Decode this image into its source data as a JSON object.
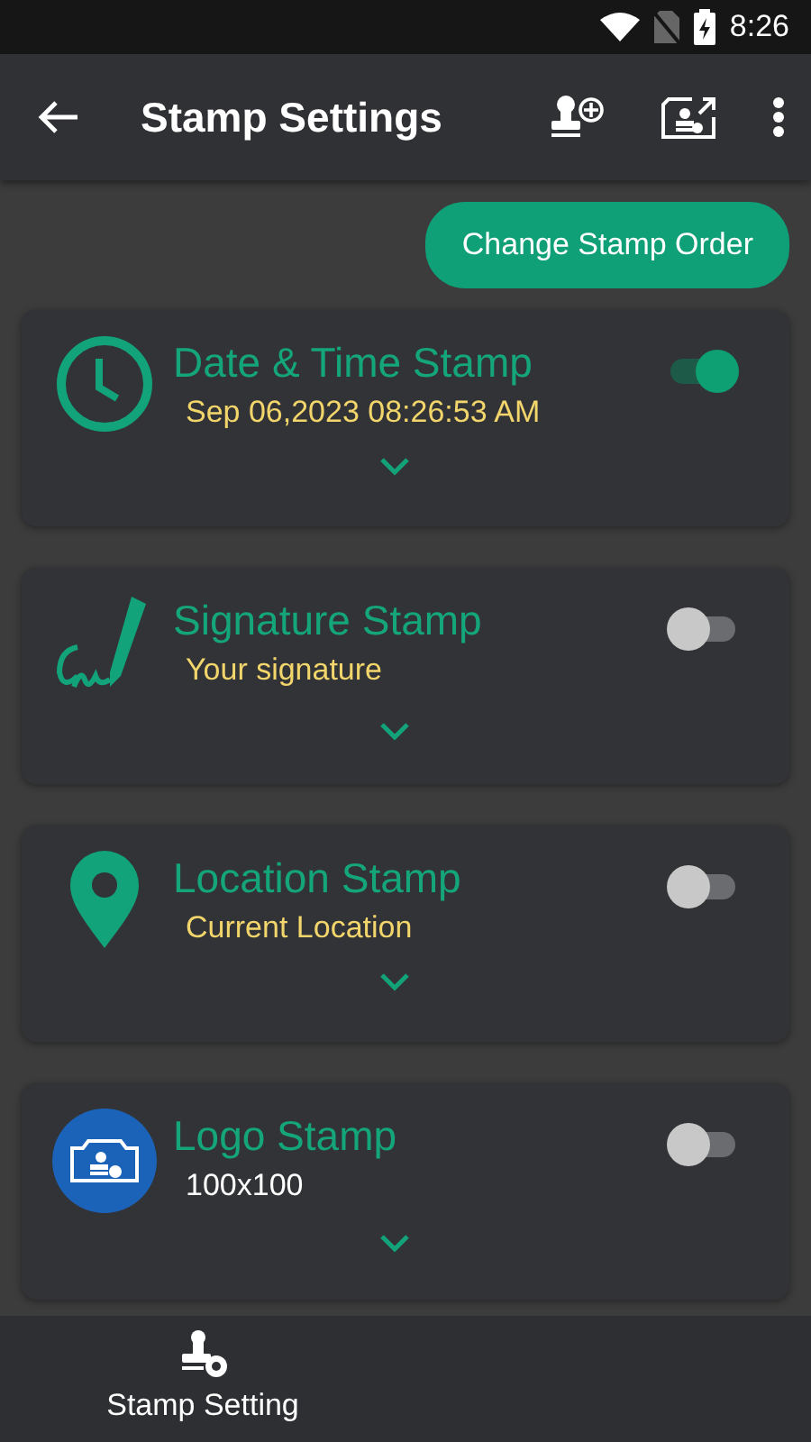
{
  "status_bar": {
    "time": "8:26"
  },
  "app_bar": {
    "title": "Stamp Settings"
  },
  "change_order_button": "Change Stamp Order",
  "stamps": [
    {
      "kind": "clock",
      "title": "Date & Time Stamp",
      "subtitle": "Sep 06,2023 08:26:53 AM",
      "color": "#f3d66b",
      "on": true
    },
    {
      "kind": "signature",
      "title": "Signature Stamp",
      "subtitle": "Your signature",
      "color": "#f3d66b",
      "on": false
    },
    {
      "kind": "location",
      "title": "Location Stamp",
      "subtitle": "Current Location",
      "color": "#f3d66b",
      "on": false
    },
    {
      "kind": "logo",
      "title": "Logo Stamp",
      "subtitle": "100x100",
      "color": "#ffffff",
      "on": false
    }
  ],
  "bottom_nav": [
    {
      "label": "Stamp Setting"
    }
  ]
}
